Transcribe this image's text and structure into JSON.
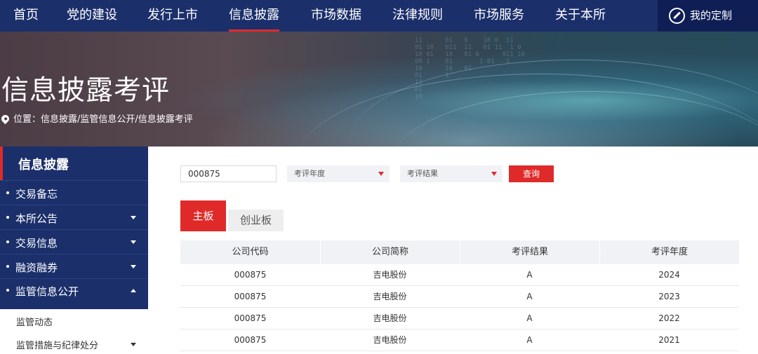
{
  "nav": {
    "items": [
      "首页",
      "党的建设",
      "发行上市",
      "信息披露",
      "市场数据",
      "法律规则",
      "市场服务",
      "关于本所"
    ],
    "active_index": 3,
    "my_custom_label": "我的定制",
    "my_custom_icon": "compass-icon"
  },
  "banner": {
    "title": "信息披露考评",
    "breadcrumb": "位置：信息披露/监管信息公开/信息披露考评",
    "location_icon": "location-pin-icon"
  },
  "sidebar": {
    "title": "信息披露",
    "items": [
      {
        "label": "交易备忘",
        "expand": "none"
      },
      {
        "label": "本所公告",
        "expand": "collapsed"
      },
      {
        "label": "交易信息",
        "expand": "collapsed"
      },
      {
        "label": "融资融券",
        "expand": "collapsed"
      },
      {
        "label": "监管信息公开",
        "expand": "expanded"
      }
    ],
    "sub_items": [
      {
        "label": "监管动态",
        "expand": "none"
      },
      {
        "label": "监管措施与纪律处分",
        "expand": "collapsed"
      }
    ]
  },
  "filters": {
    "code_value": "000875",
    "year_placeholder": "考评年度",
    "result_placeholder": "考评结果",
    "query_label": "查询"
  },
  "tabs": [
    "主板",
    "创业板"
  ],
  "table": {
    "headers": [
      "公司代码",
      "公司简称",
      "考评结果",
      "考评年度"
    ],
    "rows": [
      [
        "000875",
        "吉电股份",
        "A",
        "2024"
      ],
      [
        "000875",
        "吉电股份",
        "A",
        "2023"
      ],
      [
        "000875",
        "吉电股份",
        "A",
        "2022"
      ],
      [
        "000875",
        "吉电股份",
        "A",
        "2021"
      ]
    ]
  },
  "colors": {
    "nav_bg": "#1b2f6b",
    "accent_red": "#e02a2a",
    "panel_bg": "#f1f2f5"
  }
}
